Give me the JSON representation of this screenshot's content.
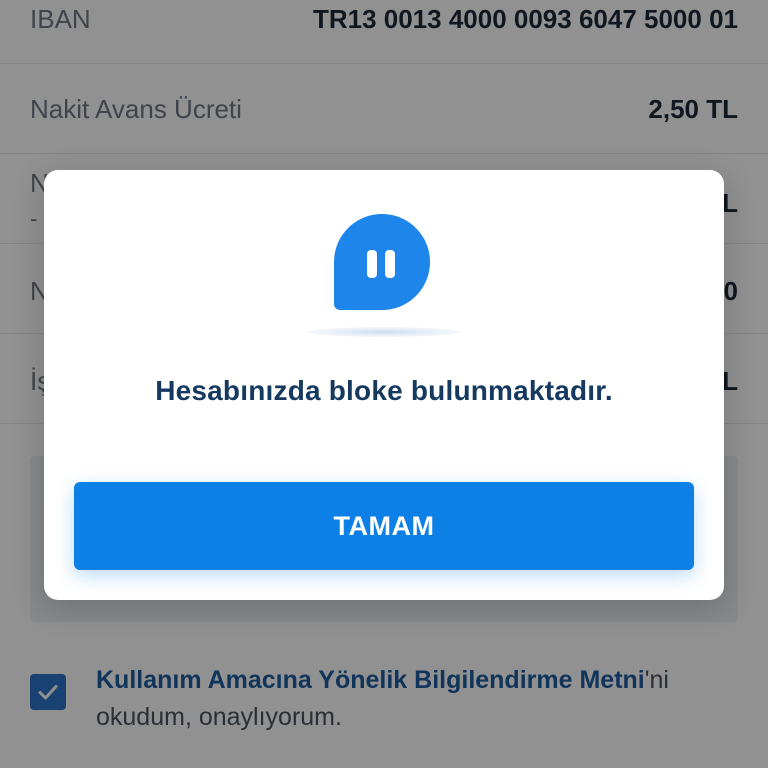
{
  "details": {
    "rows": [
      {
        "label": "IBAN",
        "value": "TR13 0013 4000 0093 6047 5000 01"
      },
      {
        "label": "Nakit Avans Ücreti",
        "value": "2,50 TL"
      },
      {
        "label": "N",
        "sublabel": "-",
        "value": "L"
      },
      {
        "label": "N",
        "value": "0"
      },
      {
        "label": "İş",
        "value": "L"
      }
    ]
  },
  "consent": {
    "link_text": "Kullanım Amacına Yönelik Bilgilendirme Metni",
    "text_suffix": "'ni okudum, onaylıyorum."
  },
  "modal": {
    "icon": "pause-chat-bubble-icon",
    "title": "Hesabınızda bloke bulunmaktadır.",
    "button_label": "TAMAM"
  },
  "colors": {
    "primary": "#0d80e7",
    "title_text": "#163a5f",
    "overlay": "#000000",
    "link": "#1f5c9f"
  }
}
